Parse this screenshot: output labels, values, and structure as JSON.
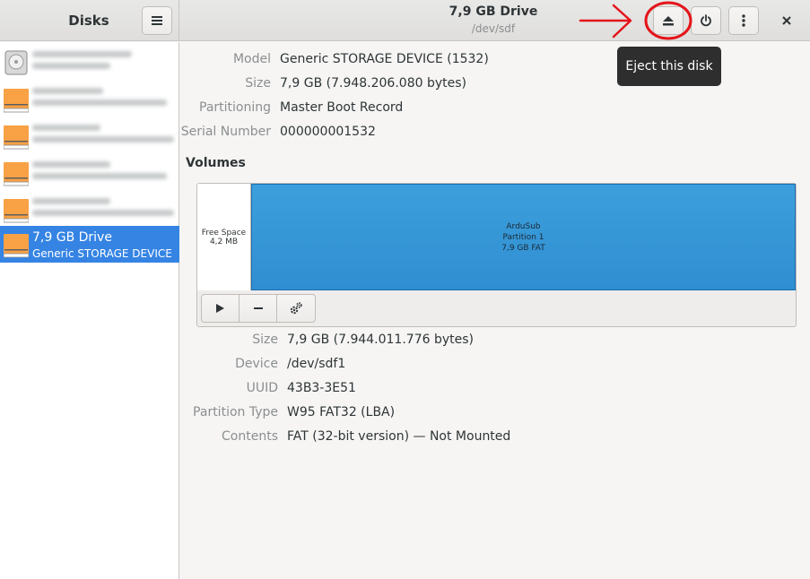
{
  "sidebar": {
    "title": "Disks",
    "selected_item": {
      "name": "7,9 GB Drive",
      "desc": "Generic STORAGE DEVICE"
    }
  },
  "header": {
    "title": "7,9 GB Drive",
    "subtitle": "/dev/sdf"
  },
  "tooltip": {
    "text": "Eject this disk"
  },
  "drive_info": [
    {
      "label": "Model",
      "value": "Generic STORAGE DEVICE (1532)"
    },
    {
      "label": "Size",
      "value": "7,9 GB (7.948.206.080 bytes)"
    },
    {
      "label": "Partitioning",
      "value": "Master Boot Record"
    },
    {
      "label": "Serial Number",
      "value": "000000001532"
    }
  ],
  "volumes": {
    "title": "Volumes",
    "free_space": {
      "line1": "Free Space",
      "line2": "4,2 MB"
    },
    "partition": {
      "line1": "ArduSub",
      "line2": "Partition 1",
      "line3": "7,9 GB FAT"
    }
  },
  "partition_info": [
    {
      "label": "Size",
      "value": "7,9 GB (7.944.011.776 bytes)"
    },
    {
      "label": "Device",
      "value": "/dev/sdf1"
    },
    {
      "label": "UUID",
      "value": "43B3-3E51"
    },
    {
      "label": "Partition Type",
      "value": "W95 FAT32 (LBA)"
    },
    {
      "label": "Contents",
      "value": "FAT (32-bit version) — Not Mounted"
    }
  ],
  "colors": {
    "accent": "#3584e4",
    "partition_fill": "#3598d7",
    "annotation": "#e5141a"
  }
}
